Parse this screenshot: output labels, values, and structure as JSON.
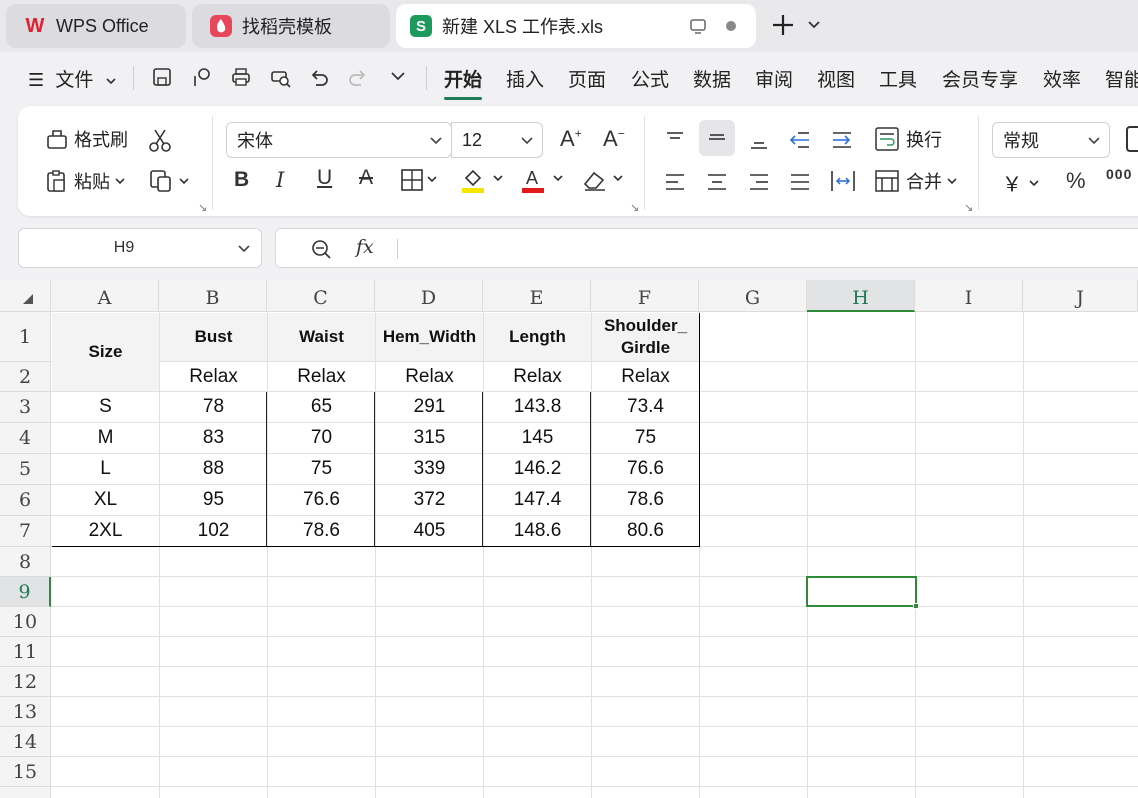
{
  "tabs": [
    {
      "label": "WPS Office",
      "icon": "wps-logo-icon"
    },
    {
      "label": "找稻壳模板",
      "icon": "docer-icon"
    },
    {
      "label": "新建 XLS 工作表.xls",
      "icon": "spreadsheet-s-icon"
    }
  ],
  "menu": {
    "file_label": "文件",
    "items": [
      "开始",
      "插入",
      "页面",
      "公式",
      "数据",
      "审阅",
      "视图",
      "工具",
      "会员专享",
      "效率",
      "智能"
    ]
  },
  "ribbon": {
    "format_painter": "格式刷",
    "paste": "粘贴",
    "font_name": "宋体",
    "font_size": "12",
    "wrap": "换行",
    "merge": "合并",
    "number_format": "常规",
    "currency_symbol": "￥",
    "percent_symbol": "%",
    "thousands_symbol": "000",
    "colors": {
      "highlight": "#f5e600",
      "font_color": "#e11919"
    }
  },
  "formula_bar": {
    "name_box": "H9",
    "fx": "fx",
    "content": ""
  },
  "columns": [
    "A",
    "B",
    "C",
    "D",
    "E",
    "F",
    "G",
    "H",
    "I",
    "J"
  ],
  "rows": [
    "1",
    "2",
    "3",
    "4",
    "5",
    "6",
    "7",
    "8",
    "9",
    "10",
    "11",
    "12",
    "13",
    "14",
    "15"
  ],
  "selected_cell": {
    "column": "H",
    "row": "9"
  },
  "table": {
    "size_header": "Size",
    "headers": [
      "Bust",
      "Waist",
      "Hem_Width",
      "Length",
      "Shoulder_\nGirdle"
    ],
    "subheaders": [
      "Relax",
      "Relax",
      "Relax",
      "Relax",
      "Relax"
    ],
    "rows": [
      [
        "S",
        "78",
        "65",
        "291",
        "143.8",
        "73.4"
      ],
      [
        "M",
        "83",
        "70",
        "315",
        "145",
        "75"
      ],
      [
        "L",
        "88",
        "75",
        "339",
        "146.2",
        "76.6"
      ],
      [
        "XL",
        "95",
        "76.6",
        "372",
        "147.4",
        "78.6"
      ],
      [
        "2XL",
        "102",
        "78.6",
        "405",
        "148.6",
        "80.6"
      ]
    ]
  }
}
